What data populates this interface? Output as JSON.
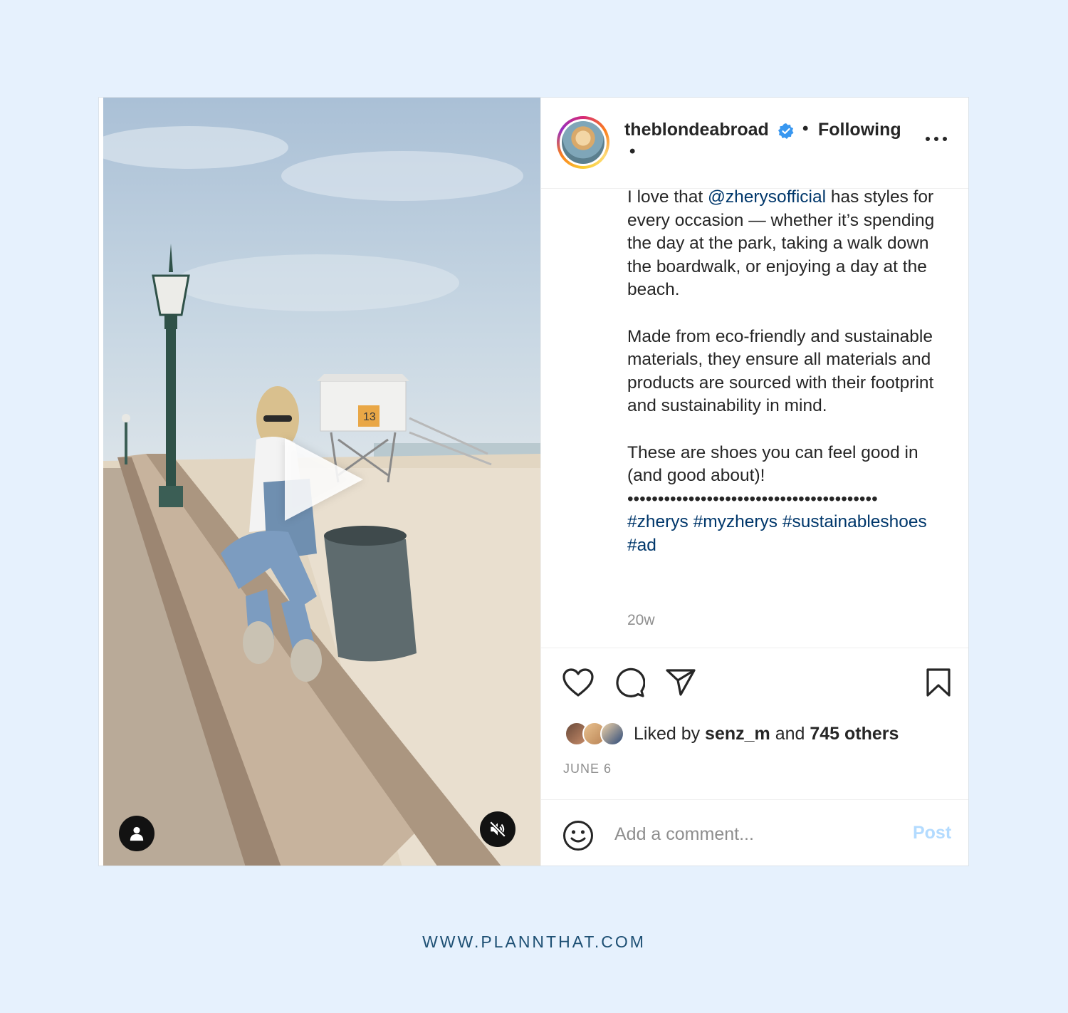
{
  "post": {
    "username": "theblondeabroad",
    "follow_status": "Following",
    "separator": "•",
    "caption": {
      "p1_before": "I love that ",
      "p1_mention": "@zherysofficial",
      "p1_after": " has styles for every occasion — whether it’s spending the day at the park, taking a walk down the boardwalk, or enjoying a day at the beach.",
      "p2": "Made from eco-friendly and sustainable materials, they ensure all materials and products are sourced with their footprint and sustainability in mind.",
      "p3": "These are shoes you can feel good in (and good about)!",
      "dots": "•••••••••••••••••••••••••••••••••••••••••",
      "hashtags": "#zherys #myzherys #sustainableshoes #ad"
    },
    "time_ago": "20w",
    "likes": {
      "prefix": "Liked by ",
      "user": "senz_m",
      "middle": " and ",
      "others": "745 others"
    },
    "date": "JUNE 6",
    "comment_placeholder": "Add a comment...",
    "post_label": "Post"
  },
  "icons": {
    "verified": "verified-badge-icon",
    "more": "more-options-icon",
    "like": "heart-icon",
    "comment": "comment-icon",
    "share": "paper-plane-icon",
    "save": "bookmark-icon",
    "emoji": "smiley-icon",
    "play": "play-icon",
    "tag": "user-tag-icon",
    "mute": "speaker-muted-icon"
  },
  "colors": {
    "page_bg": "#e6f1fd",
    "link": "#00376b",
    "verified": "#3897f0",
    "post_disabled": "#b3dbff",
    "footer": "#1d4f73"
  },
  "footer": "WWW.PLANNTHAT.COM"
}
